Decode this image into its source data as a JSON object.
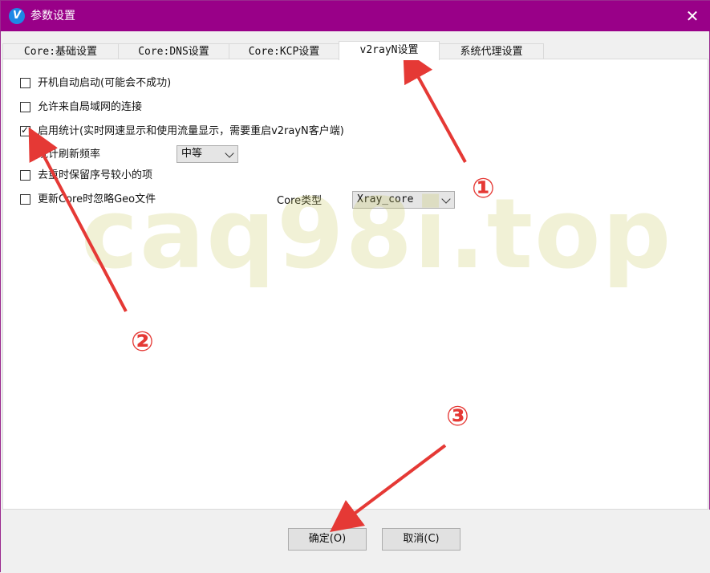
{
  "window": {
    "title": "参数设置",
    "app_icon": "v-logo-icon",
    "close_glyph": "✕"
  },
  "tabs": [
    {
      "label": "Core:基础设置",
      "active": false
    },
    {
      "label": "Core:DNS设置",
      "active": false
    },
    {
      "label": "Core:KCP设置",
      "active": false
    },
    {
      "label": "v2rayN设置",
      "active": true
    },
    {
      "label": "系统代理设置",
      "active": false
    }
  ],
  "options": {
    "autostart": {
      "label": "开机自动启动(可能会不成功)",
      "checked": false
    },
    "allow_lan": {
      "label": "允许来自局域网的连接",
      "checked": false
    },
    "enable_stats": {
      "label": "启用统计(实时网速显示和使用流量显示，需要重启v2rayN客户端)",
      "checked": true
    },
    "stats_freq": {
      "label": "统计刷新频率",
      "value": "中等"
    },
    "keep_older": {
      "label": "去重时保留序号较小的项",
      "checked": false
    },
    "ignore_geo": {
      "label": "更新Core时忽略Geo文件",
      "checked": false
    },
    "core_type": {
      "label": "Core类型",
      "value": "Xray_core"
    }
  },
  "buttons": {
    "ok": "确定(O)",
    "cancel": "取消(C)"
  },
  "overlay": {
    "watermark": "caq98i.top",
    "markers": [
      "①",
      "②",
      "③"
    ],
    "arrow_color": "#e53935"
  }
}
